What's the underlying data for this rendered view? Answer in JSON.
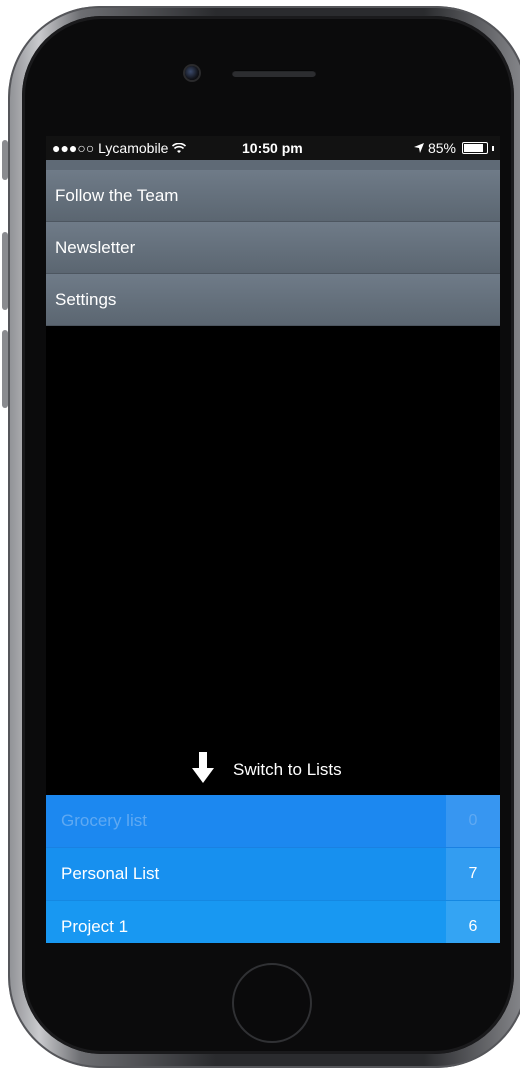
{
  "status_bar": {
    "carrier": "●●●○○ Lycamobile",
    "time": "10:50 pm",
    "battery": "85%",
    "battery_level": 0.85
  },
  "menu": {
    "items": [
      {
        "label": "Follow the Team"
      },
      {
        "label": "Newsletter"
      },
      {
        "label": "Settings"
      }
    ]
  },
  "switch": {
    "label": "Switch to Lists",
    "icon": "arrow-down-icon"
  },
  "lists": [
    {
      "name": "Grocery list",
      "count": "0"
    },
    {
      "name": "Personal List",
      "count": "7"
    },
    {
      "name": "Project 1",
      "count": "6"
    }
  ],
  "colors": {
    "menu_bg": "#66717d",
    "list_blue": "#1790ef",
    "screen_bg": "#000000"
  }
}
